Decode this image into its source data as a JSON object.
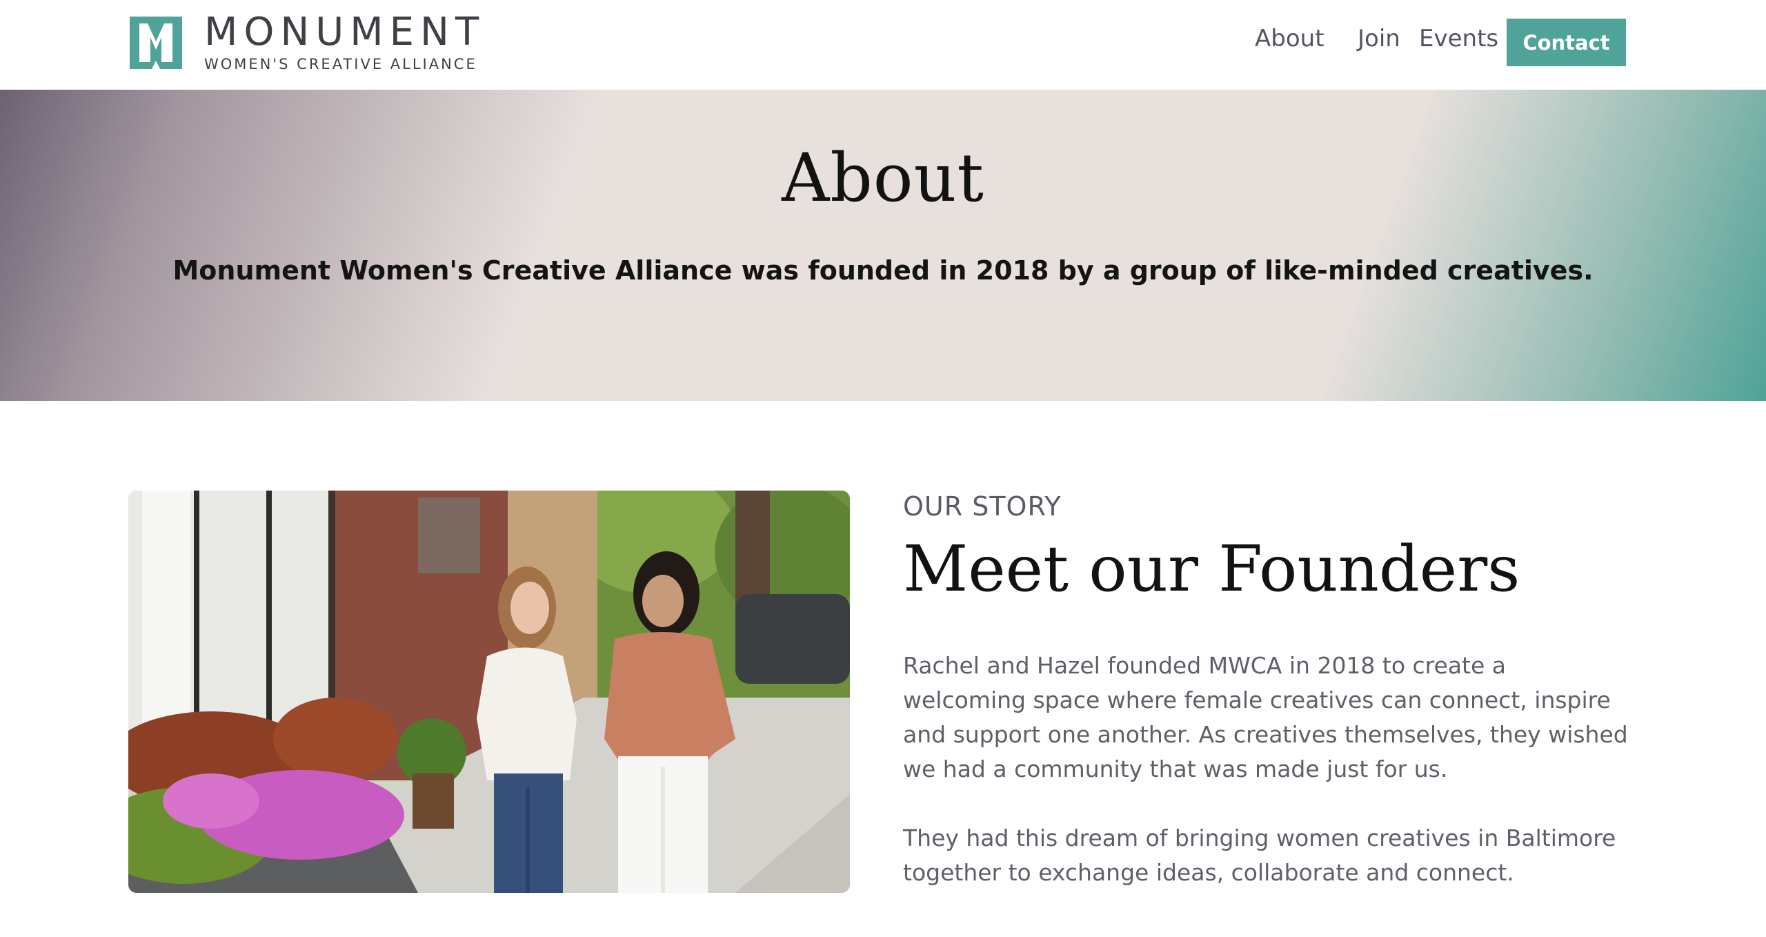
{
  "brand": {
    "name": "MONUMENT",
    "tagline": "WOMEN'S CREATIVE ALLIANCE",
    "accent": "#4fa398"
  },
  "nav": {
    "items": [
      "About",
      "Join",
      "Events"
    ],
    "contact_label": "Contact"
  },
  "hero": {
    "title": "About",
    "subtitle": "Monument Women's Creative Alliance was founded in 2018 by a group of like-minded creatives."
  },
  "story": {
    "eyebrow": "OUR STORY",
    "title": "Meet our Founders",
    "paragraphs": [
      "Rachel and Hazel founded MWCA in 2018 to create a welcoming space where female creatives can connect, inspire and support one another. As creatives themselves, they wished we had a community that was made just for us.",
      "They had this dream of bringing women creatives in Baltimore together to exchange ideas, collaborate and connect."
    ]
  },
  "photo": {
    "icon": "founders-photo"
  }
}
